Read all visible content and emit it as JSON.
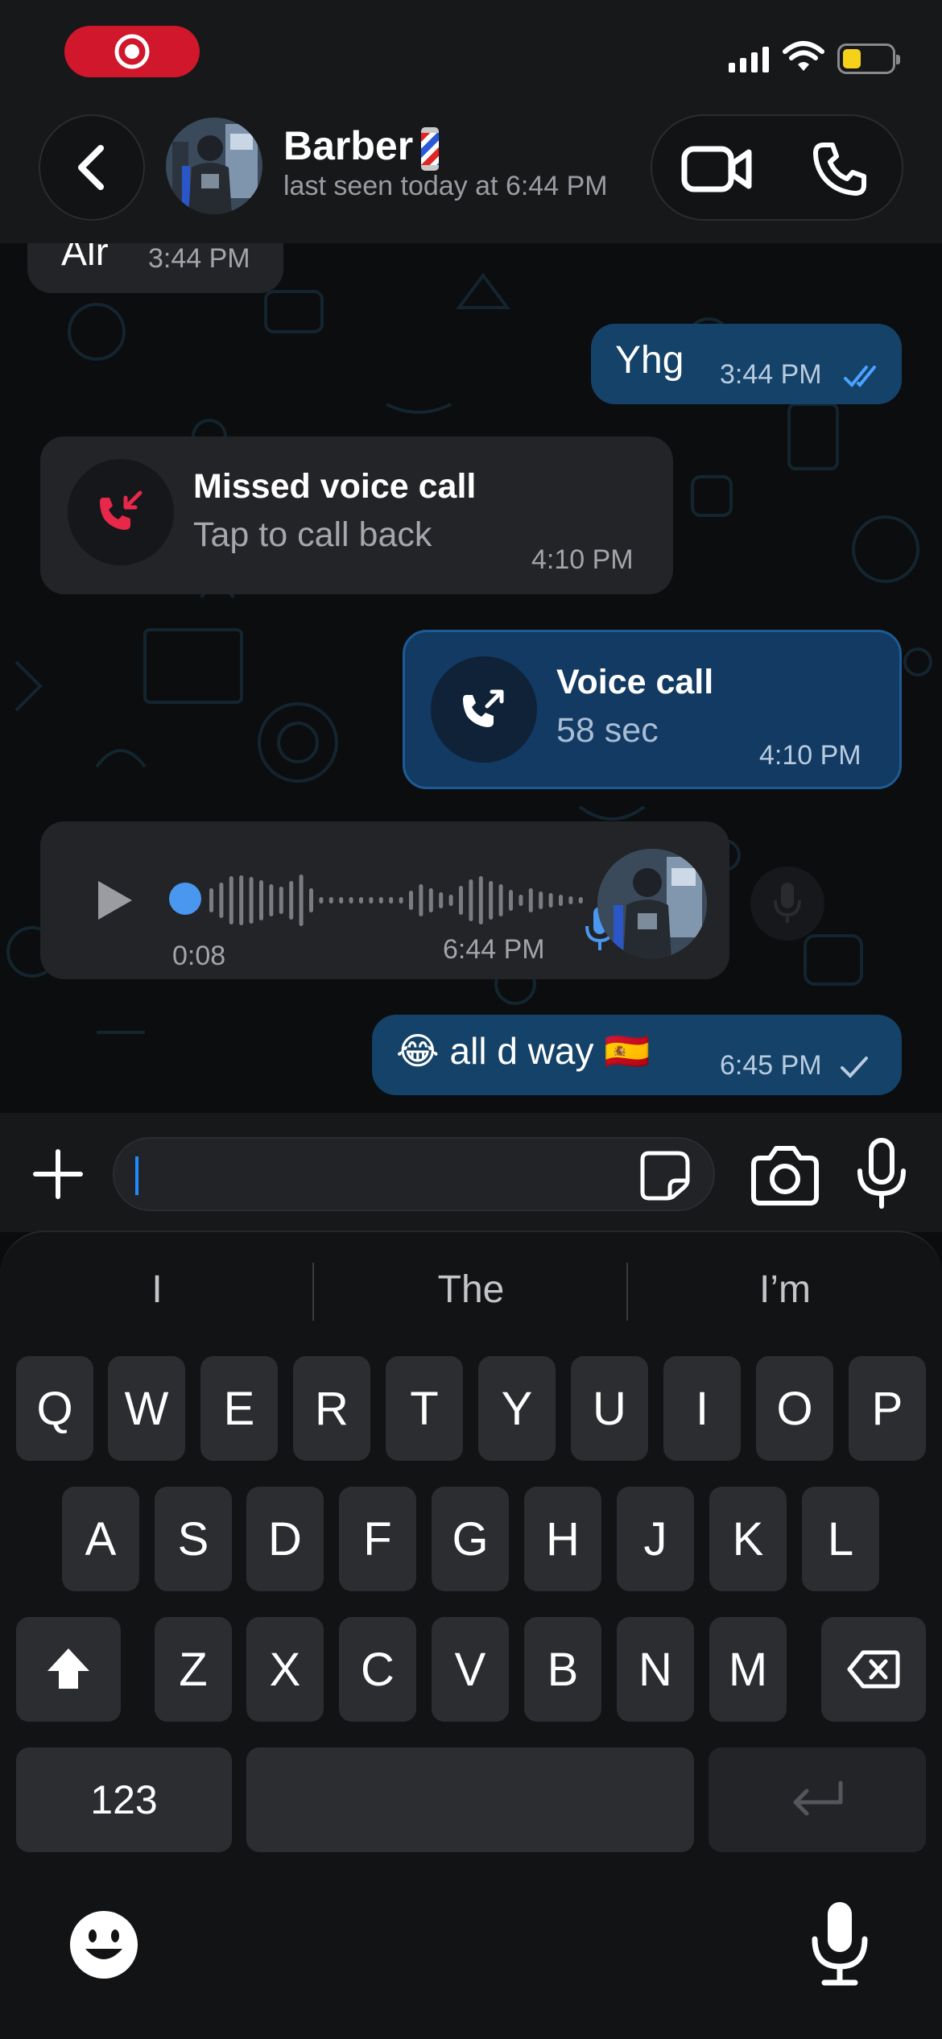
{
  "header": {
    "contact_name": "Barber",
    "contact_status": "last seen today at 6:44 PM"
  },
  "messages": [
    {
      "type": "text",
      "direction": "in",
      "text": "Alr",
      "time": "3:44 PM"
    },
    {
      "type": "text",
      "direction": "out",
      "text": "Yhg",
      "time": "3:44 PM",
      "status": "read"
    },
    {
      "type": "call",
      "direction": "in",
      "title": "Missed voice call",
      "subtitle": "Tap to call back",
      "time": "4:10 PM"
    },
    {
      "type": "call",
      "direction": "out",
      "title": "Voice call",
      "subtitle": "58 sec",
      "time": "4:10 PM"
    },
    {
      "type": "voice",
      "direction": "in",
      "duration": "0:08",
      "time": "6:44 PM",
      "progress": 0
    },
    {
      "type": "text",
      "direction": "out",
      "text": "😂 all d way 🇪🇸",
      "time": "6:45 PM",
      "status": "sent"
    }
  ],
  "keyboard": {
    "suggestions": [
      "I",
      "The",
      "I’m"
    ],
    "row1": [
      "Q",
      "W",
      "E",
      "R",
      "T",
      "Y",
      "U",
      "I",
      "O",
      "P"
    ],
    "row2": [
      "A",
      "S",
      "D",
      "F",
      "G",
      "H",
      "J",
      "K",
      "L"
    ],
    "row3": [
      "Z",
      "X",
      "C",
      "V",
      "B",
      "N",
      "M"
    ],
    "numbers_label": "123"
  },
  "colors": {
    "accent": "#1e8cff",
    "outgoing_bubble": "#144268",
    "incoming_bubble": "#232427",
    "missed_call": "#e8284a",
    "read_ticks": "#4aa3ff",
    "record_indicator": "#d0172c"
  },
  "icons": [
    "record-icon",
    "back-chevron-icon",
    "video-call-icon",
    "phone-icon",
    "missed-call-icon",
    "outgoing-call-icon",
    "play-icon",
    "mic-icon",
    "read-ticks-icon",
    "sent-tick-icon",
    "plus-icon",
    "sticker-icon",
    "camera-icon",
    "shift-icon",
    "backspace-icon",
    "return-icon",
    "emoji-icon",
    "dictation-mic-icon"
  ]
}
